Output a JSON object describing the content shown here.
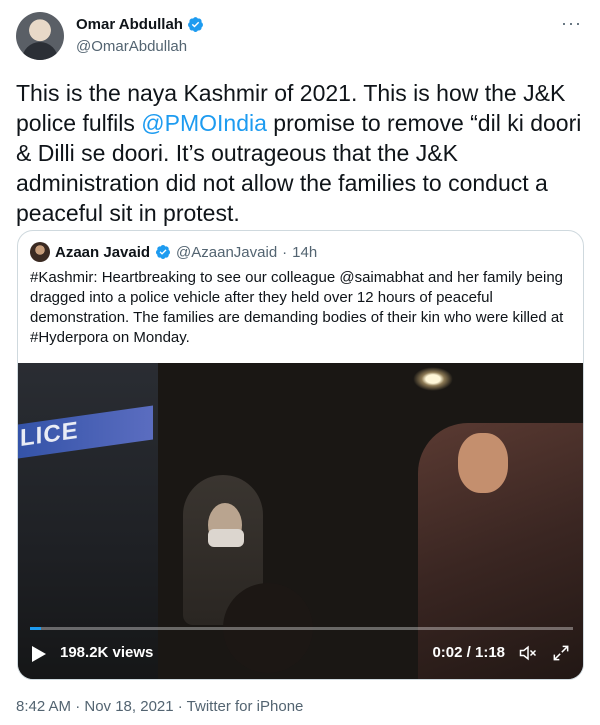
{
  "author": {
    "name": "Omar Abdullah",
    "handle": "@OmarAbdullah"
  },
  "menu": {
    "more_label": "···"
  },
  "tweet": {
    "text_before": "This is the naya Kashmir of 2021. This is how the J&K police fulfils ",
    "mention": "@PMOIndia",
    "text_after": " promise to remove “dil ki doori & Dilli se doori. It’s outrageous that the J&K administration did not allow the families to conduct a peaceful sit in protest."
  },
  "quoted": {
    "name": "Azaan Javaid",
    "handle": "@AzaanJavaid",
    "separator": "·",
    "age": "14h",
    "text": "#Kashmir: Heartbreaking to see our colleague @saimabhat and her family being dragged into a police vehicle after they held over 12 hours of peaceful demonstration. The families are demanding bodies of their kin who were killed at #Hyderpora on Monday."
  },
  "video": {
    "overlay_text": "LICE",
    "views": "198.2K views",
    "time": "0:02 / 1:18",
    "progress": 0.02
  },
  "footer": {
    "meta": "8:42 AM · Nov 18, 2021 · Twitter for iPhone"
  },
  "colors": {
    "accent": "#1d9bf0",
    "text": "#0f1419",
    "secondary": "#536471",
    "border": "#cfd9de"
  }
}
